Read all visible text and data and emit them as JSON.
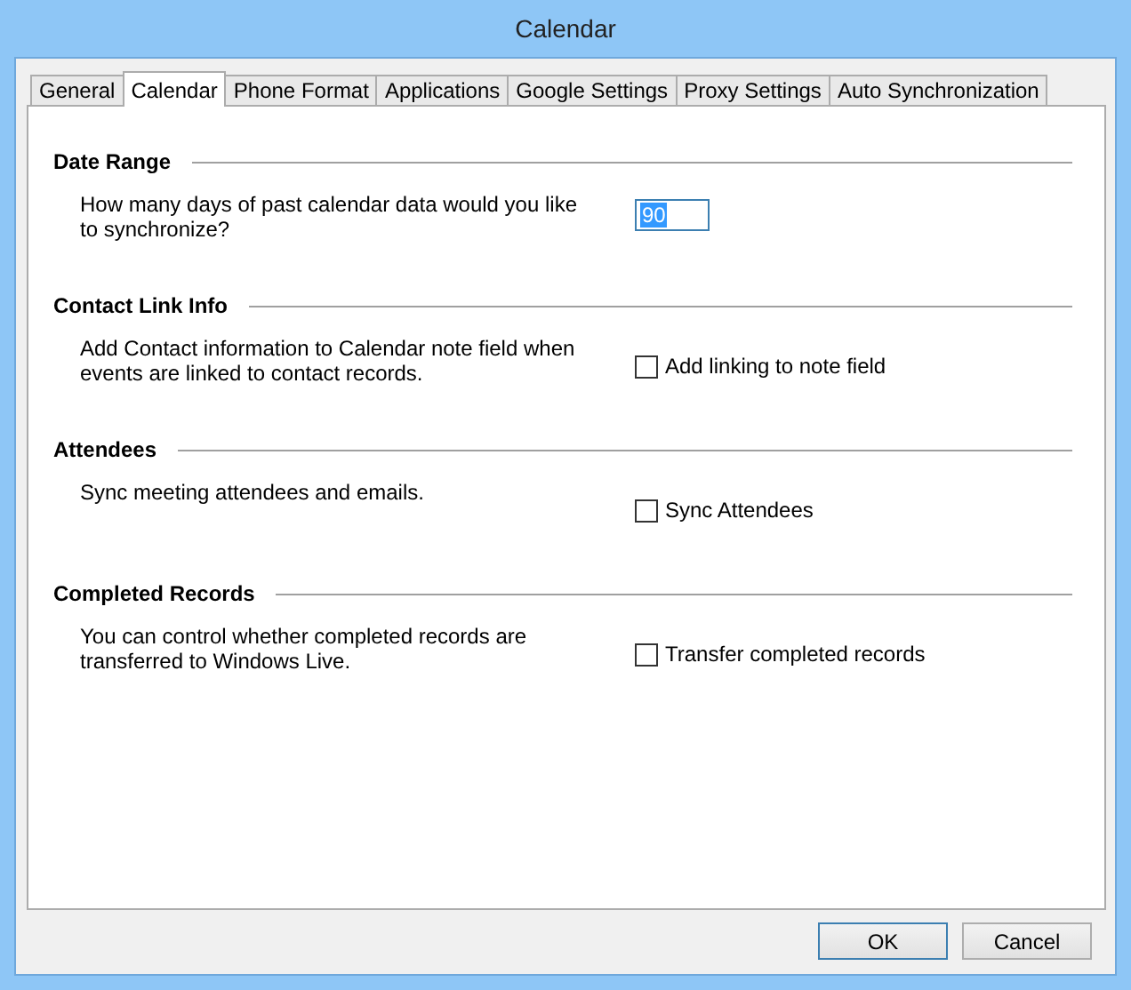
{
  "window": {
    "title": "Calendar"
  },
  "tabs": [
    {
      "label": "General",
      "selected": false
    },
    {
      "label": "Calendar",
      "selected": true
    },
    {
      "label": "Phone Format",
      "selected": false
    },
    {
      "label": "Applications",
      "selected": false
    },
    {
      "label": "Google Settings",
      "selected": false
    },
    {
      "label": "Proxy Settings",
      "selected": false
    },
    {
      "label": "Auto Synchronization",
      "selected": false
    }
  ],
  "sections": [
    {
      "title": "Date Range",
      "description": "How many days of past calendar data would you like to synchronize?",
      "kind": "number",
      "value": "90",
      "text_selected": true
    },
    {
      "title": "Contact Link Info",
      "description": "Add Contact information to Calendar note field when events are linked to contact records.",
      "kind": "checkbox",
      "label": "Add linking to note field",
      "checked": false
    },
    {
      "title": "Attendees",
      "description": "Sync meeting attendees and emails.",
      "kind": "checkbox",
      "label": "Sync Attendees",
      "checked": false
    },
    {
      "title": "Completed Records",
      "description": "You can control whether completed records are transferred to Windows Live.",
      "kind": "checkbox",
      "label": "Transfer completed records",
      "checked": false
    }
  ],
  "buttons": [
    {
      "label": "OK",
      "default": true
    },
    {
      "label": "Cancel",
      "default": false
    }
  ]
}
